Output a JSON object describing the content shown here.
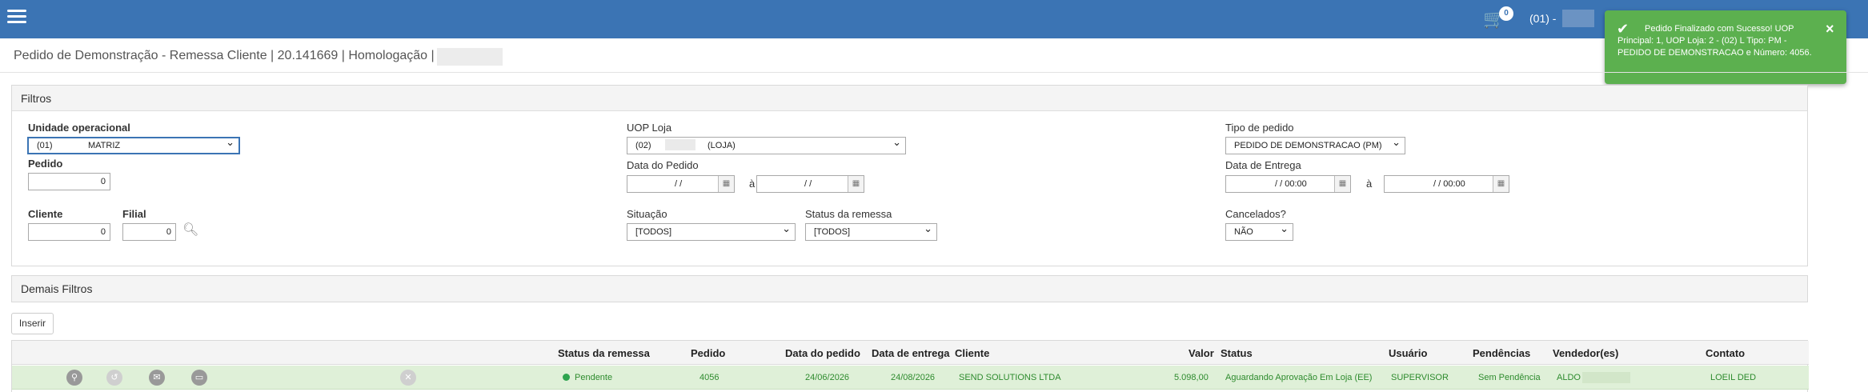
{
  "topbar": {
    "menu_icon": "hamburger-icon",
    "cart_icon": "cart-icon",
    "cart_count": "0",
    "uop_label": "(01) -"
  },
  "toast": {
    "icon": "check-icon",
    "message": "Pedido Finalizado com Sucesso! UOP Principal: 1, UOP Loja: 2 - (02) L Tipo: PM - PEDIDO DE DEMONSTRACAO e Número: 4056.",
    "close": "×",
    "color": "#5cb04f"
  },
  "page": {
    "title": "Pedido de Demonstração - Remessa Cliente | 20.141669 | Homologação |"
  },
  "filters": {
    "heading": "Filtros",
    "unidade_label": "Unidade operacional",
    "unidade_code": "(01)",
    "unidade_value": "MATRIZ",
    "pedido_label": "Pedido",
    "pedido_value": "0",
    "cliente_label": "Cliente",
    "cliente_value": "0",
    "filial_label": "Filial",
    "filial_value": "0",
    "search_icon": "search-icon",
    "uop_loja_label": "UOP Loja",
    "uop_loja_code": "(02)",
    "uop_loja_value": "(LOJA)",
    "data_pedido_label": "Data do Pedido",
    "data_pedido_from": "/ /",
    "data_pedido_to": "/ /",
    "a_sep": "à",
    "situacao_label": "Situação",
    "situacao_value": "[TODOS]",
    "status_remessa_label": "Status da remessa",
    "status_remessa_value": "[TODOS]",
    "tipo_label": "Tipo de pedido",
    "tipo_value": "PEDIDO DE DEMONSTRACAO (PM)",
    "data_entrega_label": "Data de Entrega",
    "data_entrega_from": "/ /   00:00",
    "data_entrega_to": "/ /   00:00",
    "cancelados_label": "Cancelados?",
    "cancelados_value": "NÃO",
    "calendar_icon": "calendar-icon"
  },
  "more_filters": {
    "heading": "Demais Filtros"
  },
  "actions": {
    "insert_label": "Inserir"
  },
  "table": {
    "headers": {
      "status_remessa": "Status da remessa",
      "pedido": "Pedido",
      "data_pedido": "Data do pedido",
      "data_entrega": "Data de entrega",
      "cliente": "Cliente",
      "valor": "Valor",
      "status": "Status",
      "usuario": "Usuário",
      "pendencias": "Pendências",
      "vendedores": "Vendedor(es)",
      "contato": "Contato"
    },
    "rows": [
      {
        "status_remessa": "Pendente",
        "pedido": "4056",
        "data_pedido": "24/06/2026",
        "data_entrega": "24/08/2026",
        "cliente": "SEND SOLUTIONS LTDA",
        "valor": "5.098,00",
        "status": "Aguardando Aprovação Em Loja (EE)",
        "usuario": "SUPERVISOR",
        "pendencias": "Sem Pendência",
        "vendedor": "ALDO",
        "contato": "LOEIL DED",
        "icons": [
          "search-icon",
          "history-icon",
          "mail-icon",
          "message-icon",
          "cancel-icon"
        ]
      }
    ]
  }
}
